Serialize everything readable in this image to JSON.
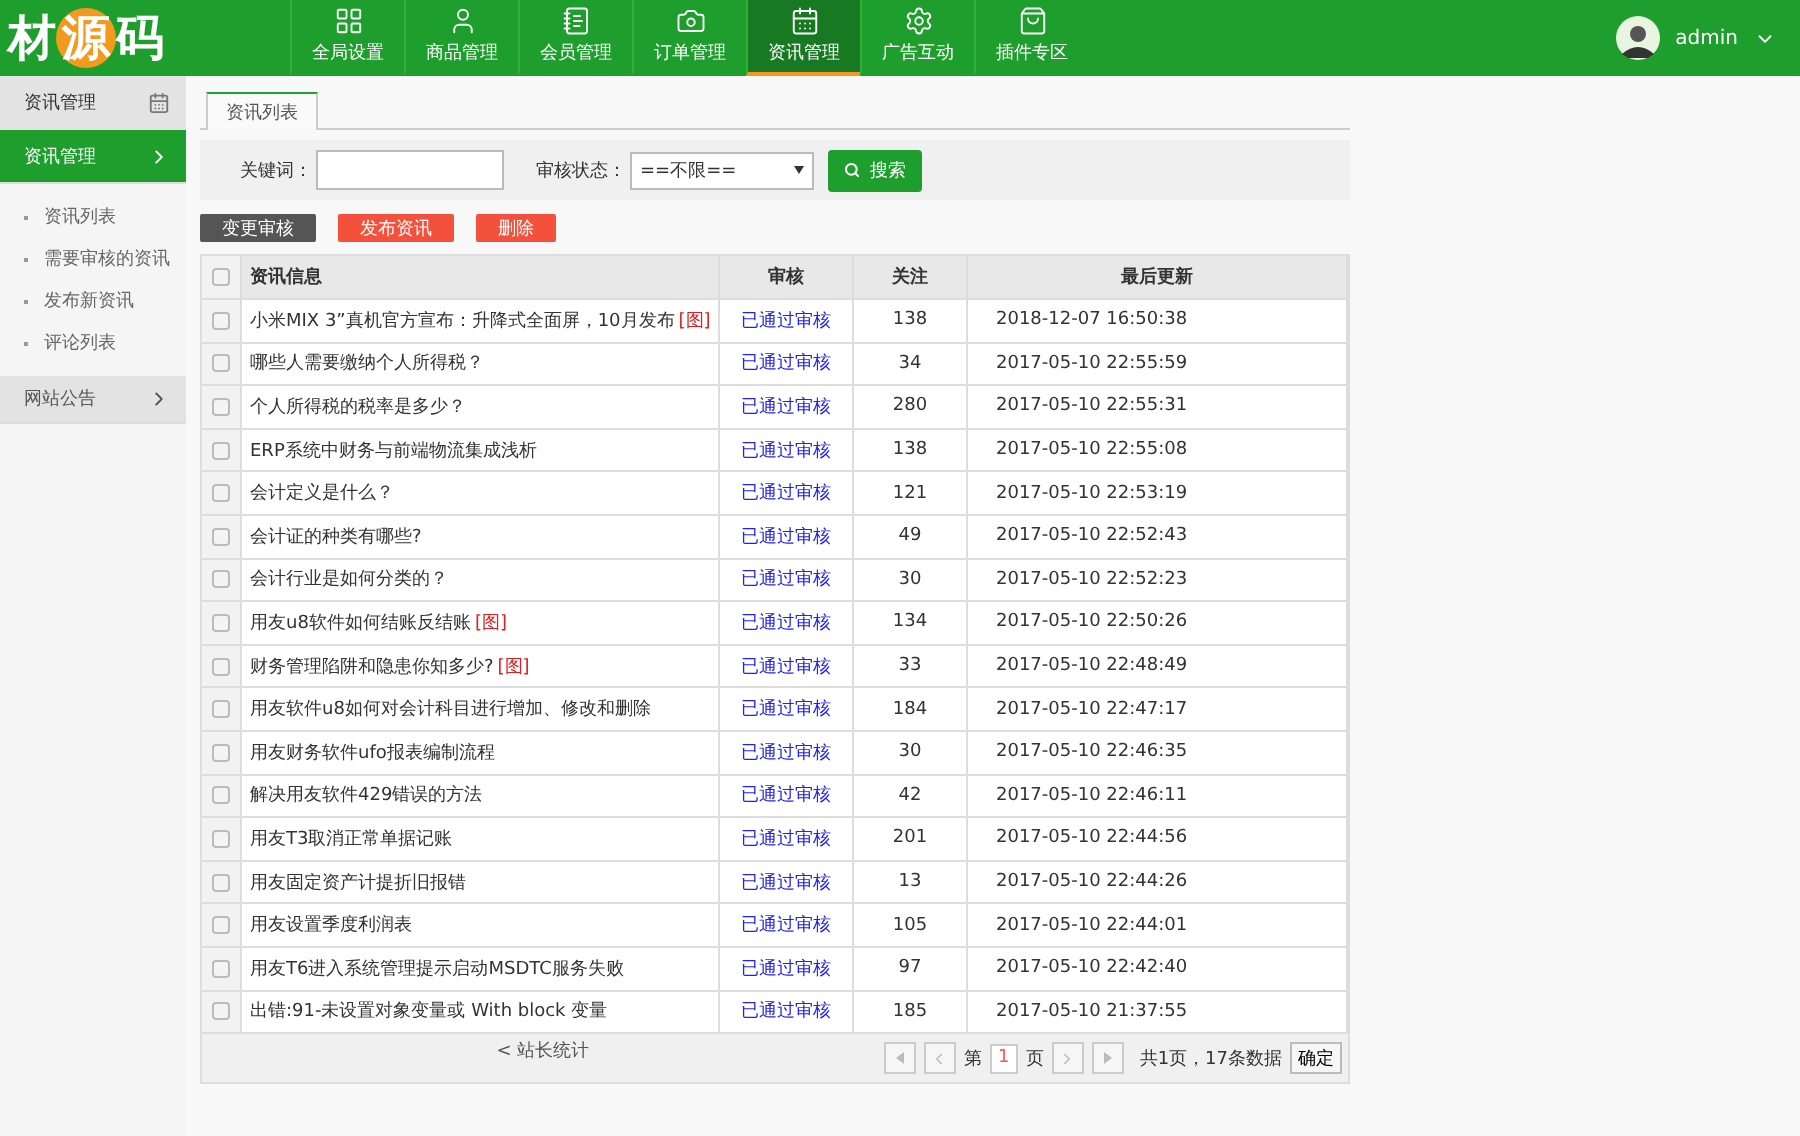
{
  "logo": {
    "parts": [
      {
        "text": "材",
        "circled": false
      },
      {
        "text": "源",
        "circled": true
      },
      {
        "text": "码",
        "circled": false
      }
    ]
  },
  "nav": [
    {
      "label": "全局设置",
      "selected": false
    },
    {
      "label": "商品管理",
      "selected": false
    },
    {
      "label": "会员管理",
      "selected": false
    },
    {
      "label": "订单管理",
      "selected": false
    },
    {
      "label": "资讯管理",
      "selected": true
    },
    {
      "label": "广告互动",
      "selected": false
    },
    {
      "label": "插件专区",
      "selected": false
    }
  ],
  "user": {
    "name": "admin"
  },
  "sidebar": {
    "title": "资讯管理",
    "groups": [
      {
        "label": "资讯管理",
        "expanded": true,
        "children": [
          {
            "label": "资讯列表"
          },
          {
            "label": "需要审核的资讯"
          },
          {
            "label": "发布新资讯"
          },
          {
            "label": "评论列表"
          }
        ]
      },
      {
        "label": "网站公告",
        "expanded": false
      }
    ]
  },
  "tabs": [
    {
      "label": "资讯列表",
      "selected": true
    }
  ],
  "filters": {
    "keyword_label": "关键词：",
    "status_label": "审核状态：",
    "status_value": "==不限==",
    "search_button": "搜索"
  },
  "actions": [
    {
      "label": "变更审核",
      "kind": "dark"
    },
    {
      "label": "发布资讯",
      "kind": "danger"
    },
    {
      "label": "删除",
      "kind": "danger"
    }
  ],
  "table": {
    "columns": [
      "资讯信息",
      "审核",
      "关注",
      "最后更新"
    ],
    "header_checked": false,
    "rows": [
      {
        "title": "小米MIX 3”真机官方宣布：升降式全面屏，10月发布",
        "tag": "[图]",
        "status": "已通过审核",
        "views": "138",
        "updated": "2018-12-07 16:50:38",
        "checked": false
      },
      {
        "title": "哪些人需要缴纳个人所得税？",
        "status": "已通过审核",
        "views": "34",
        "updated": "2017-05-10 22:55:59",
        "checked": false
      },
      {
        "title": "个人所得税的税率是多少？",
        "status": "已通过审核",
        "views": "280",
        "updated": "2017-05-10 22:55:31",
        "checked": false
      },
      {
        "title": "ERP系统中财务与前端物流集成浅析",
        "status": "已通过审核",
        "views": "138",
        "updated": "2017-05-10 22:55:08",
        "checked": false
      },
      {
        "title": "会计定义是什么？",
        "status": "已通过审核",
        "views": "121",
        "updated": "2017-05-10 22:53:19",
        "checked": false
      },
      {
        "title": "会计证的种类有哪些?",
        "status": "已通过审核",
        "views": "49",
        "updated": "2017-05-10 22:52:43",
        "checked": false
      },
      {
        "title": "会计行业是如何分类的？",
        "status": "已通过审核",
        "views": "30",
        "updated": "2017-05-10 22:52:23",
        "checked": false
      },
      {
        "title": "用友u8软件如何结账反结账",
        "tag": "[图]",
        "status": "已通过审核",
        "views": "134",
        "updated": "2017-05-10 22:50:26",
        "checked": false
      },
      {
        "title": "财务管理陷阱和隐患你知多少?",
        "tag": "[图]",
        "status": "已通过审核",
        "views": "33",
        "updated": "2017-05-10 22:48:49",
        "checked": false
      },
      {
        "title": "用友软件u8如何对会计科目进行增加、修改和删除",
        "status": "已通过审核",
        "views": "184",
        "updated": "2017-05-10 22:47:17",
        "checked": false
      },
      {
        "title": "用友财务软件ufo报表编制流程",
        "status": "已通过审核",
        "views": "30",
        "updated": "2017-05-10 22:46:35",
        "checked": false
      },
      {
        "title": "解决用友软件429错误的方法",
        "status": "已通过审核",
        "views": "42",
        "updated": "2017-05-10 22:46:11",
        "checked": false
      },
      {
        "title": "用友T3取消正常单据记账",
        "status": "已通过审核",
        "views": "201",
        "updated": "2017-05-10 22:44:56",
        "checked": false
      },
      {
        "title": "用友固定资产计提折旧报错",
        "status": "已通过审核",
        "views": "13",
        "updated": "2017-05-10 22:44:26",
        "checked": false
      },
      {
        "title": "用友设置季度利润表",
        "status": "已通过审核",
        "views": "105",
        "updated": "2017-05-10 22:44:01",
        "checked": false
      },
      {
        "title": "用友T6进入系统管理提示启动MSDTC服务失败",
        "status": "已通过审核",
        "views": "97",
        "updated": "2017-05-10 22:42:40",
        "checked": false
      },
      {
        "title": "出错:91-未设置对象变量或 With block 变量",
        "status": "已通过审核",
        "views": "185",
        "updated": "2017-05-10 21:37:55",
        "checked": false
      }
    ]
  },
  "footer": {
    "stats_link": "< 站长统计",
    "page_prefix": "第",
    "page": "1",
    "page_suffix": "页",
    "summary": "共1页，17条数据",
    "confirm": "确定"
  }
}
